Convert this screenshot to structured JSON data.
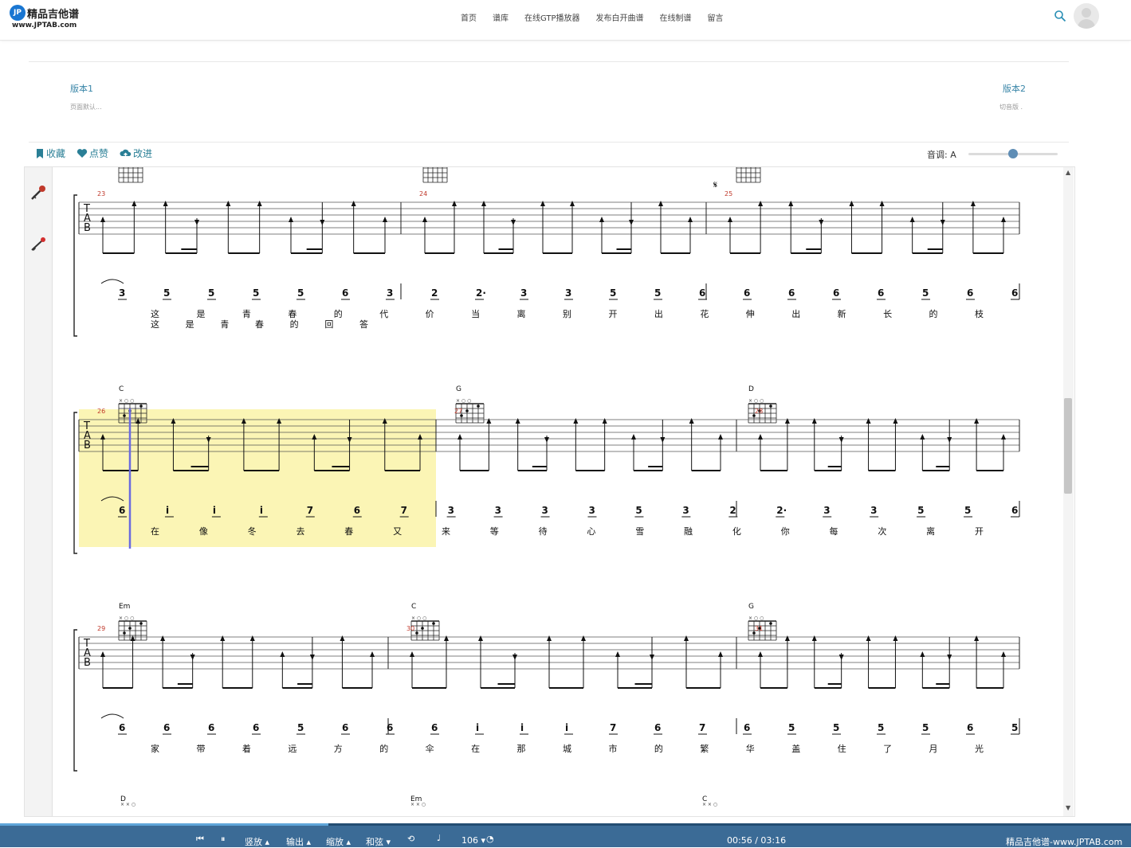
{
  "site": {
    "logo_badge": "JP",
    "logo_name": "精品吉他谱",
    "logo_url": "www.JPTAB.com"
  },
  "nav": {
    "items": [
      "首页",
      "谱库",
      "在线GTP播放器",
      "发布白开曲谱",
      "在线制谱",
      "留言"
    ]
  },
  "versions": {
    "left": {
      "title": "版本1",
      "sub": "页面默认..."
    },
    "right": {
      "title": "版本2",
      "sub": "切音版 ."
    }
  },
  "actions": {
    "favorite": "收藏",
    "like": "点赞",
    "improve": "改进"
  },
  "pitch": {
    "label": "音调: A",
    "level_fraction": 0.5
  },
  "score": {
    "rows": [
      {
        "measures": [
          "23",
          "24",
          "25"
        ],
        "chords": [],
        "tab_letters": [
          "T",
          "A",
          "B"
        ],
        "jianpu": [
          "3",
          "5",
          "5",
          "5",
          "5",
          "6",
          "3",
          "2",
          "2·",
          "3",
          "3",
          "5",
          "5",
          "6",
          "6",
          "6",
          "6",
          "6",
          "5",
          "6",
          "6"
        ],
        "lyrics1": [
          "这",
          "是",
          "青",
          "春",
          "的",
          "代",
          "价",
          "当",
          "离",
          "别",
          "开",
          "出",
          "花",
          "伸",
          "出",
          "新",
          "长",
          "的",
          "枝"
        ],
        "lyrics2": [
          "这",
          "是",
          "青",
          "春",
          "的",
          "回",
          "答"
        ],
        "segno": "𝄋"
      },
      {
        "measures": [
          "26",
          "27",
          "28"
        ],
        "chords": [
          "C",
          "G",
          "D"
        ],
        "tab_letters": [
          "T",
          "A",
          "B"
        ],
        "jianpu": [
          "6",
          "i",
          "i",
          "i",
          "7",
          "6",
          "7",
          "3",
          "3",
          "3",
          "3",
          "5",
          "3",
          "2",
          "2·",
          "3",
          "3",
          "5",
          "5",
          "6"
        ],
        "lyrics1": [
          "在",
          "像",
          "冬",
          "去",
          "春",
          "又",
          "来",
          "等",
          "待",
          "心",
          "雪",
          "融",
          "化",
          "你",
          "每",
          "次",
          "离",
          "开"
        ]
      },
      {
        "measures": [
          "29",
          "30",
          "31"
        ],
        "chords": [
          "Em",
          "C",
          "G"
        ],
        "tab_letters": [
          "T",
          "A",
          "B"
        ],
        "jianpu": [
          "6",
          "6",
          "6",
          "6",
          "5",
          "6",
          "6",
          "6",
          "i",
          "i",
          "i",
          "7",
          "6",
          "7",
          "6",
          "5",
          "5",
          "5",
          "5",
          "6",
          "5"
        ],
        "lyrics1": [
          "家",
          "带",
          "着",
          "远",
          "方",
          "的",
          "伞",
          "在",
          "那",
          "城",
          "市",
          "的",
          "繁",
          "华",
          "盖",
          "住",
          "了",
          "月",
          "光"
        ]
      },
      {
        "measures": [],
        "chords": [
          "D",
          "Em",
          "C"
        ]
      }
    ]
  },
  "player": {
    "vertical": "竖放",
    "output": "输出",
    "zoom": "缩放",
    "chord": "和弦",
    "speed": "106",
    "time": "00:56 / 03:16",
    "brand": "精品吉他谱-www.JPTAB.com",
    "progress_fraction": 0.29
  },
  "colors": {
    "accent": "#2a7f96",
    "player_bar": "#3b6b96",
    "highlight": "#fbf5b5",
    "cursor": "#6a6adf"
  }
}
